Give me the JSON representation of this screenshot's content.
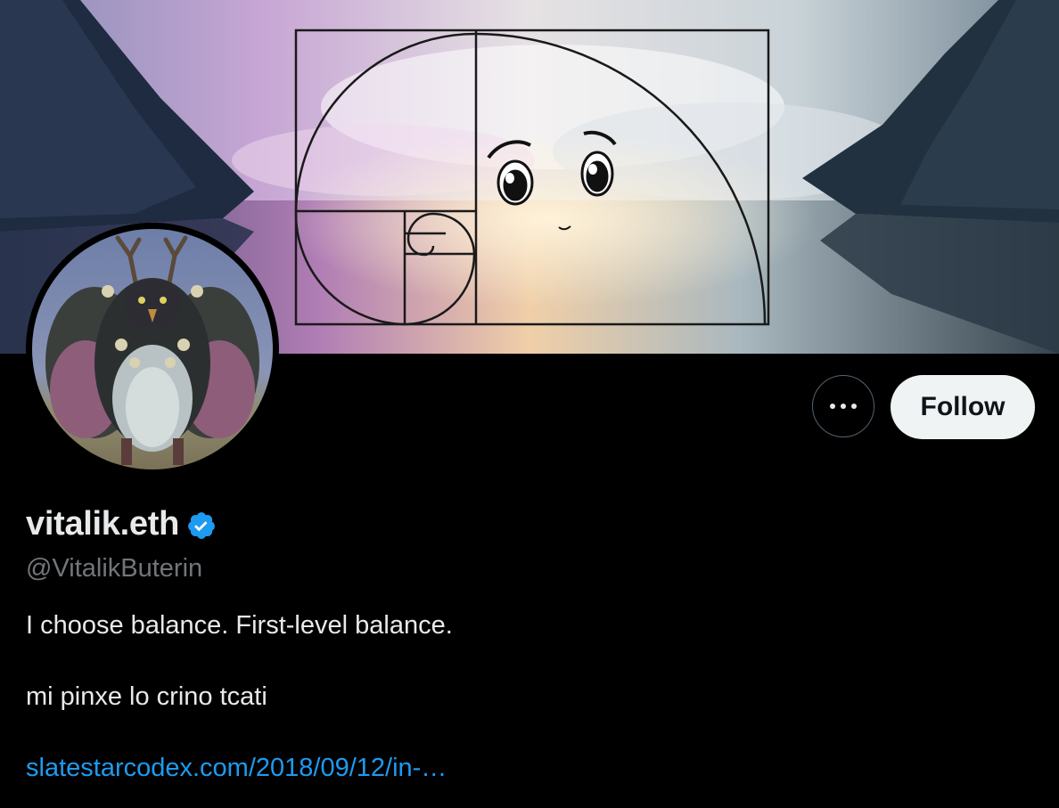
{
  "profile": {
    "display_name": "vitalik.eth",
    "handle": "@VitalikButerin",
    "verified": true,
    "bio_line_1": "I choose balance. First-level balance.",
    "bio_line_2": "mi pinxe lo crino tcati",
    "link_text": "slatestarcodex.com/2018/09/12/in-…"
  },
  "actions": {
    "follow_label": "Follow",
    "more_icon": "ellipsis-icon"
  },
  "colors": {
    "background": "#000000",
    "text_primary": "#e7e9ea",
    "text_secondary": "#71767b",
    "link": "#1d9bf0",
    "verified_badge": "#1d9bf0",
    "follow_button_bg": "#eff3f4"
  }
}
